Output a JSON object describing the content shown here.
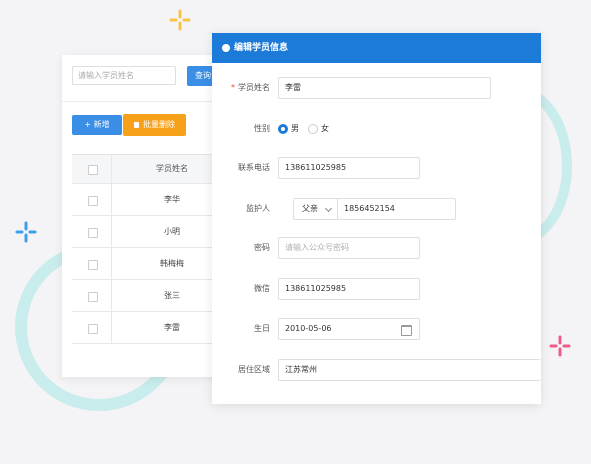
{
  "list": {
    "search_placeholder": "请输入学员姓名",
    "search_label": "查询",
    "new_label": "+ 新增",
    "batch_delete_label": "批量删除",
    "column_name": "学员姓名",
    "rows": [
      "李华",
      "小明",
      "韩梅梅",
      "张三",
      "李雷"
    ]
  },
  "edit": {
    "title": "编辑学员信息",
    "labels": {
      "name": "学员姓名",
      "gender": "性别",
      "phone": "联系电话",
      "guardian": "监护人",
      "password": "密码",
      "wechat": "微信",
      "birthday": "生日",
      "region": "居住区域"
    },
    "values": {
      "name": "李雷",
      "gender_male": "男",
      "gender_female": "女",
      "phone": "13861102598​5",
      "guardian_relation": "父亲",
      "guardian_phone": "1856452154",
      "password_placeholder": "请输入公众号密码",
      "wechat": "13861102598​5",
      "birthday": "2010-05-06",
      "region": "江苏常州"
    }
  },
  "colors": {
    "primary": "#1c7ad8",
    "warning": "#f7a11a",
    "decor_ring": "#c9ecec"
  }
}
